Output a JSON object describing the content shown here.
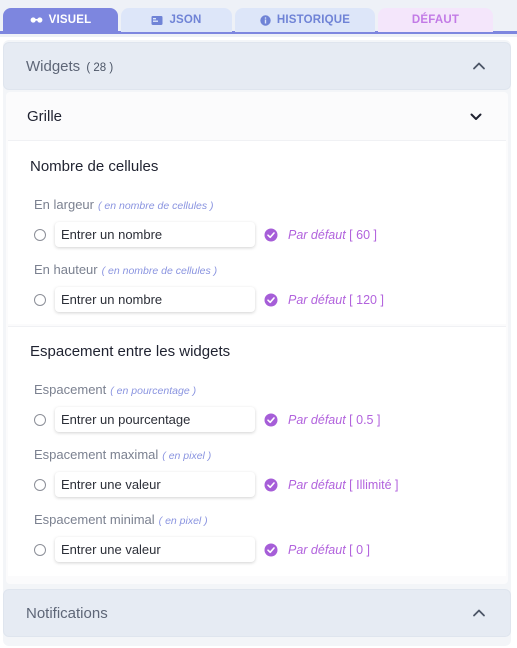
{
  "tabs": [
    {
      "label": "VISUEL",
      "icon": "glasses-icon",
      "active": true
    },
    {
      "label": "JSON",
      "icon": "code-block-icon"
    },
    {
      "label": "HISTORIQUE",
      "icon": "info-icon"
    },
    {
      "label": "DÉFAUT"
    }
  ],
  "widgets_section": {
    "title": "Widgets",
    "count": "( 28 )",
    "expanded": true
  },
  "grid": {
    "title": "Grille"
  },
  "cells": {
    "title": "Nombre de cellules",
    "fields": [
      {
        "label": "En largeur",
        "hint": "( en nombre de cellules )",
        "placeholder": "Entrer un nombre",
        "default_label": "Par défaut",
        "default_value": "[ 60 ]"
      },
      {
        "label": "En hauteur",
        "hint": "( en nombre de cellules )",
        "placeholder": "Entrer un nombre",
        "default_label": "Par défaut",
        "default_value": "[ 120 ]"
      }
    ]
  },
  "spacing": {
    "title": "Espacement entre les widgets",
    "fields": [
      {
        "label": "Espacement",
        "hint": "( en pourcentage )",
        "placeholder": "Entrer un pourcentage",
        "default_label": "Par défaut",
        "default_value": "[ 0.5 ]"
      },
      {
        "label": "Espacement maximal",
        "hint": "( en pixel )",
        "placeholder": "Entrer une valeur",
        "default_label": "Par défaut",
        "default_value": "[ Illimité ]"
      },
      {
        "label": "Espacement minimal",
        "hint": "( en pixel )",
        "placeholder": "Entrer une valeur",
        "default_label": "Par défaut",
        "default_value": "[ 0 ]"
      }
    ]
  },
  "notifications_section": {
    "title": "Notifications",
    "expanded": false
  },
  "colors": {
    "accent": "#7d86df",
    "default_purple": "#b263dd",
    "check_purple": "#a65ed8"
  }
}
